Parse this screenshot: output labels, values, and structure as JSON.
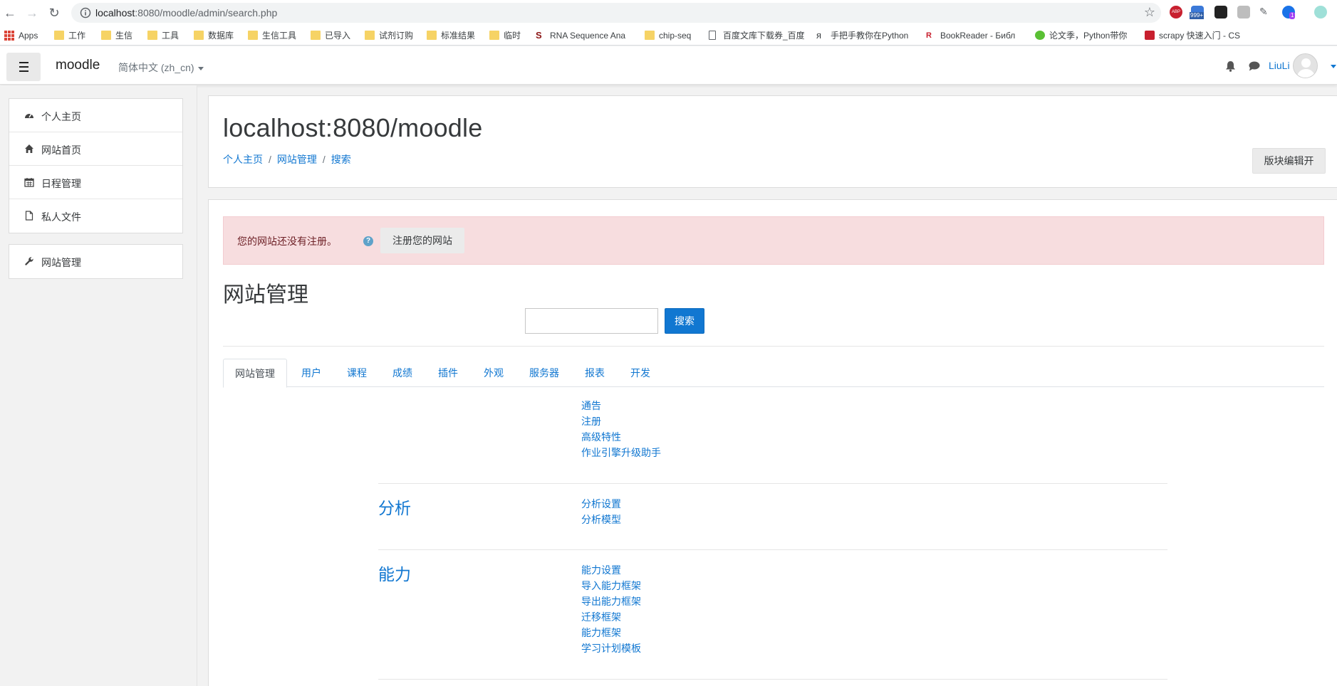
{
  "browser": {
    "url_host": "localhost",
    "url_rest": ":8080/moodle/admin/search.php",
    "bookmarks": [
      {
        "label": "Apps",
        "icon": "apps-icon"
      },
      {
        "label": "工作",
        "icon": "folder-icon"
      },
      {
        "label": "生信",
        "icon": "folder-icon"
      },
      {
        "label": "工具",
        "icon": "folder-icon"
      },
      {
        "label": "数据库",
        "icon": "folder-icon"
      },
      {
        "label": "生信工具",
        "icon": "folder-icon"
      },
      {
        "label": "已导入",
        "icon": "folder-icon"
      },
      {
        "label": "试剂订购",
        "icon": "folder-icon"
      },
      {
        "label": "标准结果",
        "icon": "folder-icon"
      },
      {
        "label": "临时",
        "icon": "folder-icon"
      },
      {
        "label": "RNA Sequence Ana",
        "icon": "stanford-icon"
      },
      {
        "label": "chip-seq",
        "icon": "folder-icon"
      },
      {
        "label": "百度文库下载券_百度",
        "icon": "page-icon"
      },
      {
        "label": "手把手教你在Python",
        "icon": "ya-icon"
      },
      {
        "label": "BookReader - Библ",
        "icon": "bookreader-icon"
      },
      {
        "label": "论文季，Python带你",
        "icon": "green-e-icon"
      },
      {
        "label": "scrapy 快速入门 - CS",
        "icon": "csdn-icon"
      }
    ],
    "extensions": {
      "badge_count": "999+",
      "notif_count": "1",
      "abp_label": "ABP"
    }
  },
  "navbar": {
    "brand": "moodle",
    "language": "简体中文 (zh_cn)",
    "user": "LiuLi"
  },
  "drawer": {
    "items": [
      {
        "label": "个人主页",
        "icon": "dashboard-icon"
      },
      {
        "label": "网站首页",
        "icon": "home-icon"
      },
      {
        "label": "日程管理",
        "icon": "calendar-icon"
      },
      {
        "label": "私人文件",
        "icon": "file-icon"
      }
    ],
    "admin": {
      "label": "网站管理",
      "icon": "wrench-icon"
    }
  },
  "header": {
    "site_title": "localhost:8080/moodle",
    "breadcrumb": [
      "个人主页",
      "网站管理",
      "搜索"
    ],
    "block_edit_label": "版块编辑开"
  },
  "notice": {
    "text": "您的网站还没有注册。",
    "register_label": "注册您的网站"
  },
  "main": {
    "heading": "网站管理",
    "search_label": "搜索",
    "search_value": "",
    "tabs": [
      "网站管理",
      "用户",
      "课程",
      "成绩",
      "插件",
      "外观",
      "服务器",
      "报表",
      "开发"
    ],
    "active_tab": "网站管理",
    "top_links": [
      "通告",
      "注册",
      "高级特性",
      "作业引擎升级助手"
    ],
    "sections": [
      {
        "title": "分析",
        "links": [
          "分析设置",
          "分析模型"
        ]
      },
      {
        "title": "能力",
        "links": [
          "能力设置",
          "导入能力框架",
          "导出能力框架",
          "迁移框架",
          "能力框架",
          "学习计划模板"
        ]
      }
    ]
  },
  "colors": {
    "link": "#1177d1",
    "notice_bg": "#f7dddf",
    "primary_button": "#1177d1"
  }
}
